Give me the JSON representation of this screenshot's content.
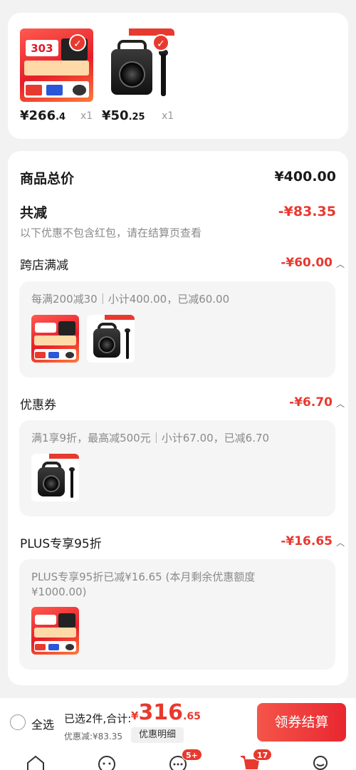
{
  "top_items": [
    {
      "price_main": "¥266",
      "price_dec": ".4",
      "qty": "x1"
    },
    {
      "price_main": "¥50",
      "price_dec": ".25",
      "qty": "x1"
    }
  ],
  "thumb_text": "303",
  "summary": {
    "total_label": "商品总价",
    "total_value": "¥400.00",
    "discount_label": "共减",
    "discount_value": "-¥83.35",
    "discount_note": "以下优惠不包含红包，请在结算页查看"
  },
  "sections": [
    {
      "label": "跨店满减",
      "value": "-¥60.00",
      "detail": "每满200减30｜小计400.00，已减60.00"
    },
    {
      "label": "优惠券",
      "value": "-¥6.70",
      "detail": "满1享9折，最高减500元｜小计67.00，已减6.70"
    },
    {
      "label": "PLUS专享95折",
      "value": "-¥16.65",
      "detail_line1": "PLUS专享95折已减¥16.65 (本月剩余优惠额度",
      "detail_line2": "¥1000.00)"
    }
  ],
  "bottom": {
    "select_all": "全选",
    "selected_info": "已选2件,合计:",
    "currency": "¥",
    "total_int": "316",
    "total_dec": ".65",
    "saved": "优惠减:¥83.35",
    "detail_button": "优惠明细",
    "checkout_button": "领券结算"
  },
  "tabbar": {
    "badge_messages": "5+",
    "badge_cart": "17"
  },
  "colors": {
    "accent": "#e8392f",
    "background": "#f2f2f2"
  }
}
